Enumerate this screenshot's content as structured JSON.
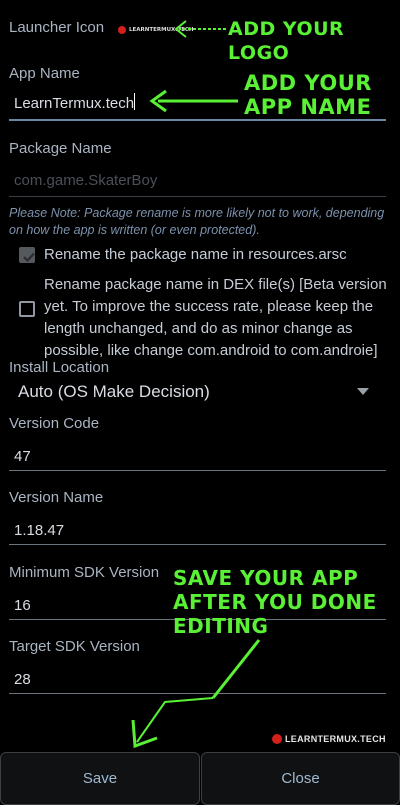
{
  "launcher": {
    "label": "Launcher Icon",
    "logo_text": "LEARNTERMUX.TECH"
  },
  "app_name": {
    "label": "App Name",
    "value": "LearnTermux.tech"
  },
  "package": {
    "label": "Package Name",
    "placeholder": "com.game.SkaterBoy"
  },
  "note": "Please Note: Package rename is more likely not to work, depending on how the app is written (or even protected).",
  "options": {
    "resources_label": "Rename the package name in resources.arsc",
    "dex_label": "Rename package name in DEX file(s) [Beta version yet. To improve the success rate, please keep the length unchanged, and do as minor change as possible, like change com.android to com.androie]"
  },
  "install": {
    "label": "Install Location",
    "selected": "Auto (OS Make Decision)"
  },
  "version_code": {
    "label": "Version Code",
    "value": "47"
  },
  "version_name": {
    "label": "Version Name",
    "value": "1.18.47"
  },
  "min_sdk": {
    "label": "Minimum SDK Version",
    "value": "16"
  },
  "target_sdk": {
    "label": "Target SDK Version",
    "value": "28"
  },
  "annotations": {
    "logo": "ADD YOUR LOGO",
    "name_line1": "ADD YOUR",
    "name_line2": "APP NAME",
    "save_line1": "SAVE YOUR APP",
    "save_line2": "AFTER YOU DONE",
    "save_line3": "EDITING"
  },
  "watermark": "LEARNTERMUX.TECH",
  "buttons": {
    "save": "Save",
    "close": "Close"
  },
  "colors": {
    "annotation": "#5af036",
    "background": "#000000",
    "accent_line": "#6b87a6"
  }
}
